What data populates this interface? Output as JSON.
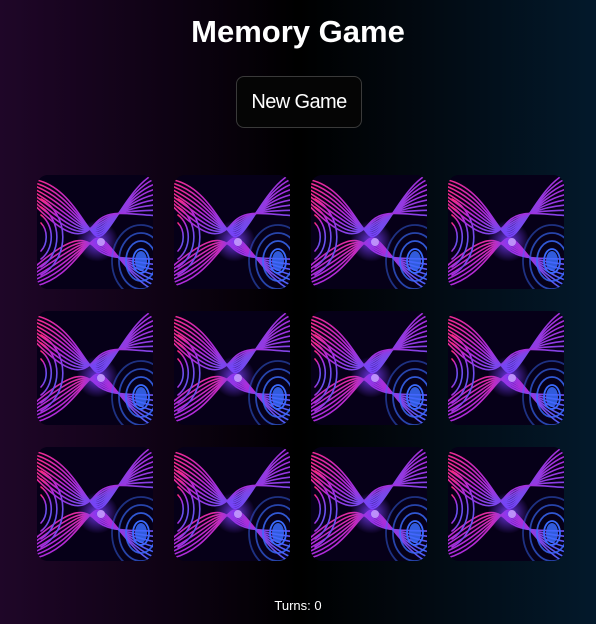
{
  "game": {
    "title": "Memory Game",
    "new_game_label": "New Game",
    "turns_text": "Turns: 0",
    "turns": 0,
    "card_count": 12,
    "card_back_icon": "swirl-pattern-card-back",
    "colors": {
      "accent_pink": "#ff2a7a",
      "accent_blue": "#3a6bff",
      "background_left": "#1f0628",
      "background_right": "#03192b"
    }
  }
}
